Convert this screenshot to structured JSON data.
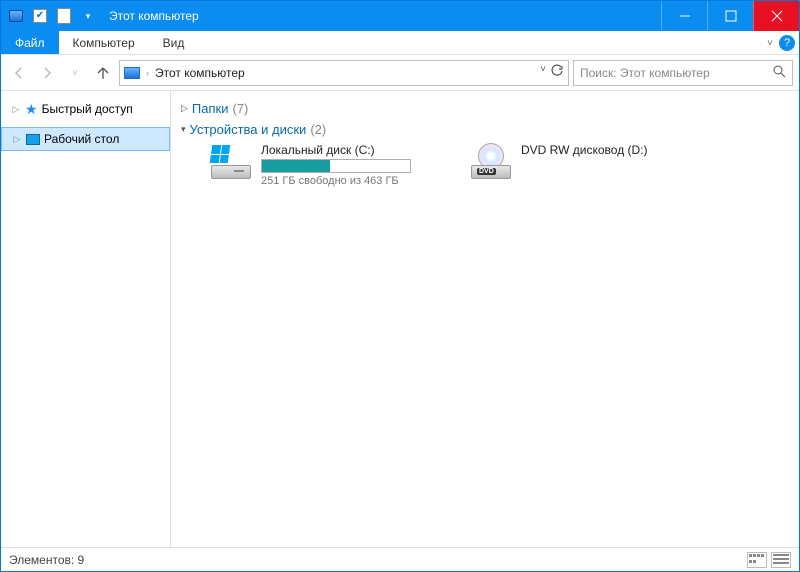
{
  "titlebar": {
    "title": "Этот компьютер"
  },
  "menu": {
    "file": "Файл",
    "computer": "Компьютер",
    "view": "Вид"
  },
  "breadcrumb": {
    "location": "Этот компьютер"
  },
  "search": {
    "placeholder": "Поиск: Этот компьютер"
  },
  "sidebar": {
    "quick_access": "Быстрый доступ",
    "desktop": "Рабочий стол"
  },
  "groups": {
    "folders": {
      "label": "Папки",
      "count": "(7)"
    },
    "devices": {
      "label": "Устройства и диски",
      "count": "(2)"
    }
  },
  "drives": {
    "c": {
      "name": "Локальный диск (C:)",
      "free_text": "251 ГБ свободно из 463 ГБ",
      "used_percent": 46
    },
    "d": {
      "name": "DVD RW дисковод (D:)"
    }
  },
  "statusbar": {
    "count_label": "Элементов: 9"
  }
}
